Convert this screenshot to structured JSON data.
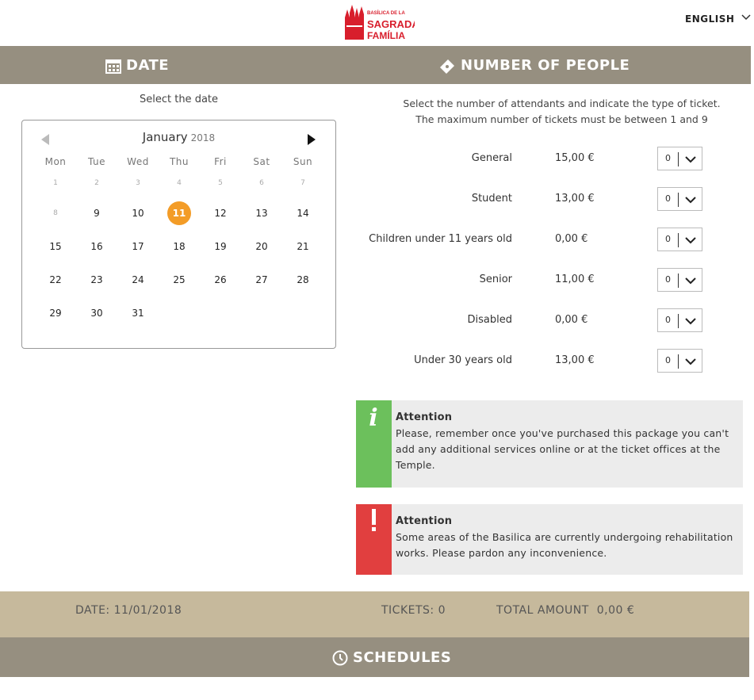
{
  "header": {
    "logo_text_line1": "BASÍLICA DE LA",
    "logo_text_line2": "SAGRADA",
    "logo_text_line3": "FAMÍLIA",
    "language": "ENGLISH"
  },
  "date_section": {
    "title": "DATE",
    "subtitle": "Select the date"
  },
  "calendar": {
    "month": "January",
    "year": "2018",
    "weekdays": [
      "Mon",
      "Tue",
      "Wed",
      "Thu",
      "Fri",
      "Sat",
      "Sun"
    ],
    "weeks": [
      [
        "1",
        "2",
        "3",
        "4",
        "5",
        "6",
        "7"
      ],
      [
        "8",
        "9",
        "10",
        "11",
        "12",
        "13",
        "14"
      ],
      [
        "15",
        "16",
        "17",
        "18",
        "19",
        "20",
        "21"
      ],
      [
        "22",
        "23",
        "24",
        "25",
        "26",
        "27",
        "28"
      ],
      [
        "29",
        "30",
        "31",
        "",
        "",
        "",
        ""
      ]
    ],
    "selected_day": "11",
    "disabled_days": [
      "1",
      "2",
      "3",
      "4",
      "5",
      "6",
      "7",
      "8"
    ]
  },
  "people_section": {
    "title": "NUMBER OF PEOPLE",
    "instructions": "Select the number of attendants and indicate the type of ticket. The maximum number of tickets must be between 1 and 9",
    "tickets": [
      {
        "name": "General",
        "price": "15,00 €",
        "qty": "0"
      },
      {
        "name": "Student",
        "price": "13,00 €",
        "qty": "0"
      },
      {
        "name": "Children under 11 years old",
        "price": "0,00 €",
        "qty": "0"
      },
      {
        "name": "Senior",
        "price": "11,00 €",
        "qty": "0"
      },
      {
        "name": "Disabled",
        "price": "0,00 €",
        "qty": "0"
      },
      {
        "name": "Under 30 years old",
        "price": "13,00 €",
        "qty": "0"
      }
    ]
  },
  "notices": [
    {
      "heading": "Attention",
      "body": "Please, remember once you've purchased this package you can't add any additional services online or at the ticket offices at the Temple.",
      "color": "#6cc05c",
      "icon": "info-icon"
    },
    {
      "heading": "Attention",
      "body": "Some areas of the Basilica are currently undergoing rehabilitation works. Please pardon any inconvenience.",
      "color": "#e13f3f",
      "icon": "exclamation-icon"
    }
  ],
  "summary": {
    "date": "DATE: 11/01/2018",
    "tickets": "TICKETS: 0",
    "total_label": "TOTAL AMOUNT",
    "total_value": "0,00 €"
  },
  "schedules": {
    "title": "SCHEDULES"
  },
  "colors": {
    "bar": "#968f80",
    "summary": "#c6b99c",
    "selected_day": "#f39c27",
    "logo_red": "#d81e2c"
  }
}
